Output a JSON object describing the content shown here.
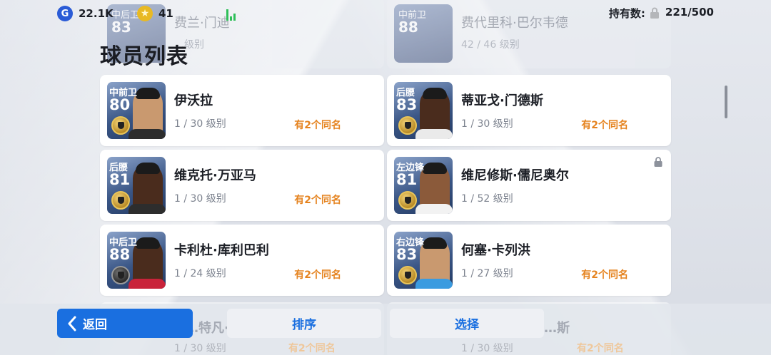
{
  "resources": {
    "gp": {
      "icon": "g-coin-icon",
      "value": "22.1K"
    },
    "coins": {
      "icon": "star-coin-icon",
      "value": "41"
    }
  },
  "holding": {
    "label": "持有数:",
    "value": "221/500"
  },
  "page_title": "球员列表",
  "ghost_top": [
    {
      "pos": "中后卫",
      "ovr": "83",
      "name": "费兰·门迪",
      "level": "…级别"
    },
    {
      "pos": "中前卫",
      "ovr": "88",
      "name": "费代里科·巴尔韦德",
      "level": "42 / 46 级别"
    }
  ],
  "players": [
    {
      "pos": "中前卫",
      "ovr": "80",
      "name": "伊沃拉",
      "level": "1 / 30 级别",
      "dup": "有2个同名",
      "badge": "gold",
      "skin": "light",
      "shirt": "#2d2d2d",
      "locked": false
    },
    {
      "pos": "后腰",
      "ovr": "83",
      "name": "蒂亚戈·门德斯",
      "level": "1 / 30 级别",
      "dup": "有2个同名",
      "badge": "gold",
      "skin": "dark",
      "shirt": "#eaeaea",
      "locked": false
    },
    {
      "pos": "后腰",
      "ovr": "81",
      "name": "维克托·万亚马",
      "level": "1 / 30 级别",
      "dup": "有2个同名",
      "badge": "gold",
      "skin": "dark",
      "shirt": "#2d2d2d",
      "locked": false
    },
    {
      "pos": "左边锋",
      "ovr": "81",
      "name": "维尼修斯·儒尼奥尔",
      "level": "1 / 52 级别",
      "dup": "",
      "badge": "gold",
      "skin": "medium",
      "shirt": "#f2f2f2",
      "locked": true
    },
    {
      "pos": "中后卫",
      "ovr": "88",
      "name": "卡利杜·库利巴利",
      "level": "1 / 24 级别",
      "dup": "有2个同名",
      "badge": "dark",
      "skin": "dark",
      "shirt": "#c9233a",
      "locked": false
    },
    {
      "pos": "右边锋",
      "ovr": "83",
      "name": "何塞·卡列洪",
      "level": "1 / 27 级别",
      "dup": "有2个同名",
      "badge": "gold",
      "skin": "light",
      "shirt": "#3a9be0",
      "locked": false
    }
  ],
  "ghost_bottom": [
    {
      "name": "…特凡·…",
      "level": "1 / 30 级别",
      "dup": "有2个同名"
    },
    {
      "name": "…斯",
      "level": "1 / 30 级别",
      "dup": "有2个同名"
    }
  ],
  "buttons": {
    "back": "返回",
    "sort": "排序",
    "select": "选择"
  }
}
